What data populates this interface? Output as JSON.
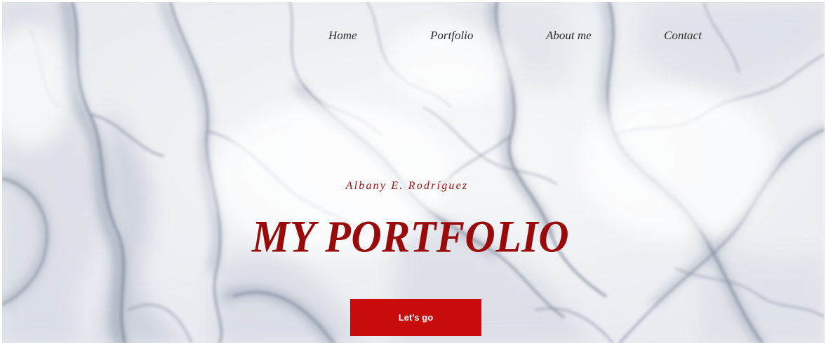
{
  "nav": {
    "items": [
      {
        "label": "Home"
      },
      {
        "label": "Portfolio"
      },
      {
        "label": "About me"
      },
      {
        "label": "Contact"
      }
    ]
  },
  "hero": {
    "subtitle": "Albany E. Rodríguez",
    "title": "MY PORTFOLIO",
    "cta_label": "Let's go",
    "background": "white-grey-marble-texture"
  },
  "colors": {
    "accent": "#c80b0b",
    "title": "#990a0a",
    "nav_text": "#2b2b2b",
    "marble_vein": "#8a93a6"
  }
}
